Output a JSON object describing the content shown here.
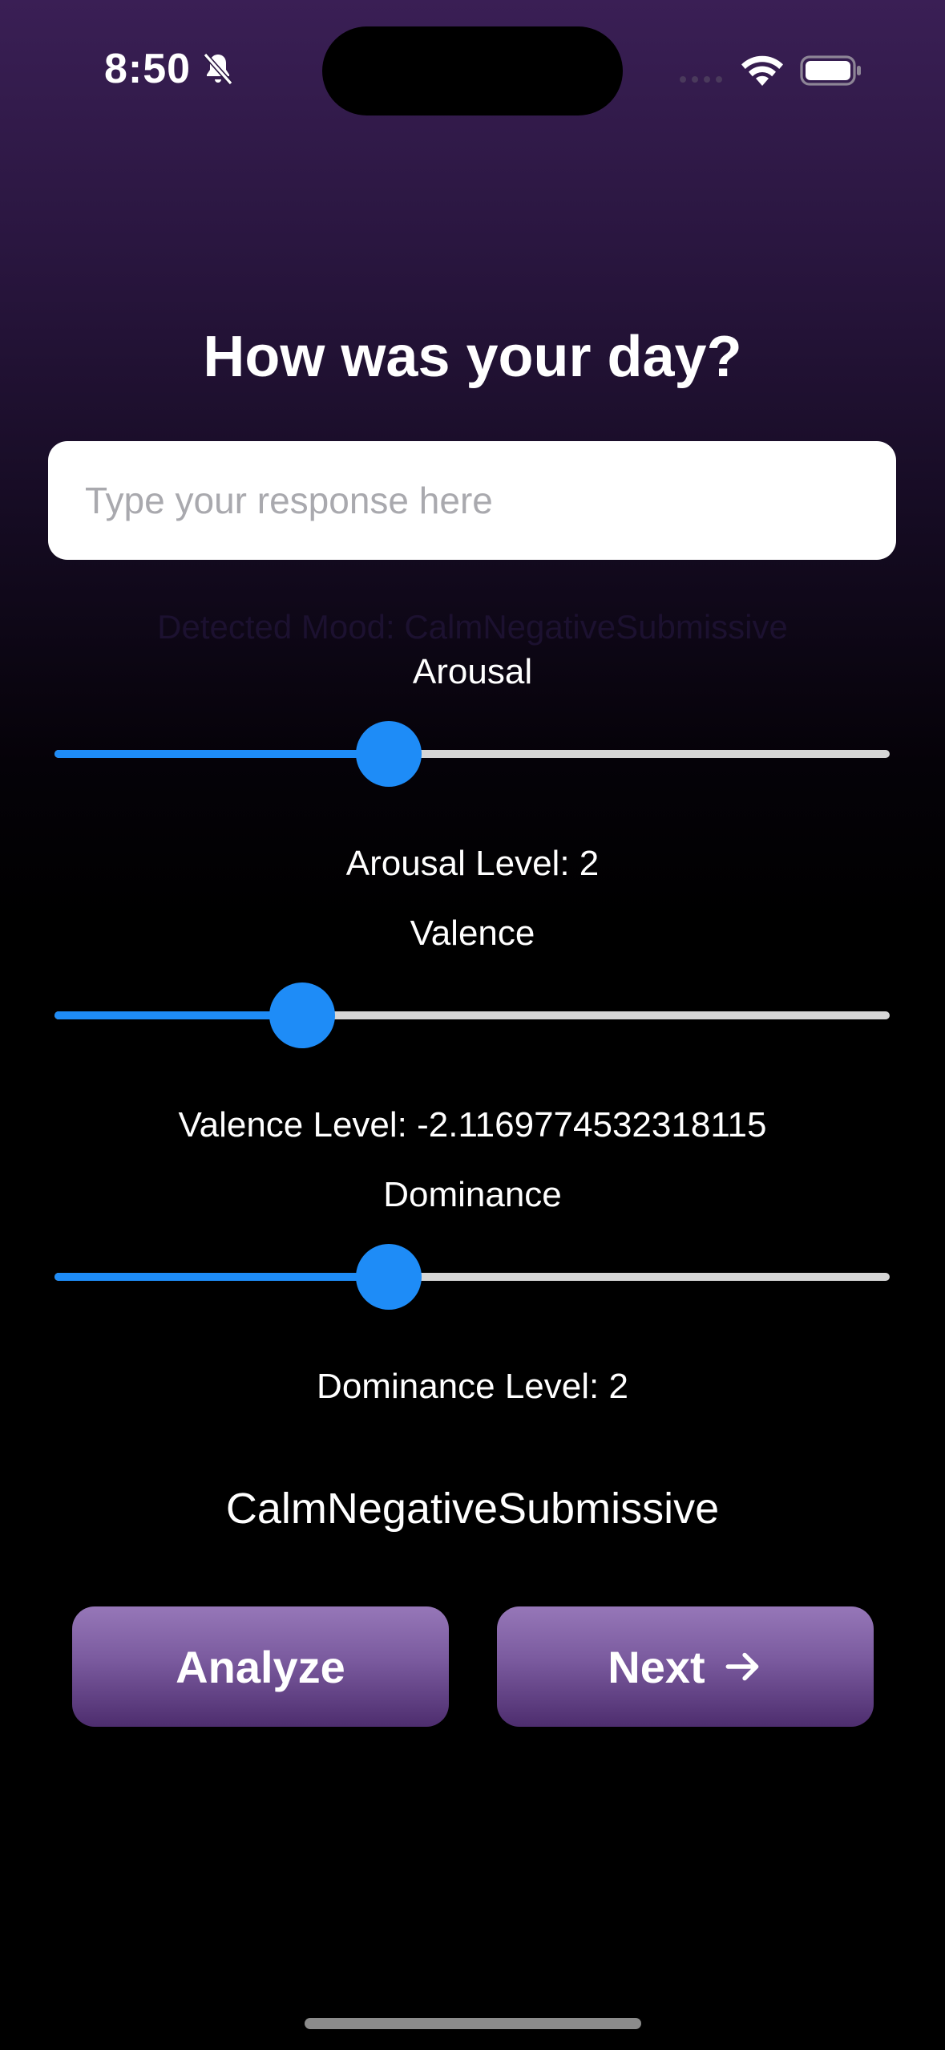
{
  "status_bar": {
    "time": "8:50",
    "icons": [
      "bell-slash-icon",
      "cellular-signal-icon",
      "wifi-icon",
      "battery-icon"
    ]
  },
  "question": {
    "title": "How was your day?"
  },
  "response_input": {
    "placeholder": "Type your response here",
    "value": ""
  },
  "detected_mood_label": "Detected Mood: CalmNegativeSubmissive",
  "sliders": {
    "arousal": {
      "label": "Arousal",
      "level_text": "Arousal Level: 2",
      "fraction": 0.4
    },
    "valence": {
      "label": "Valence",
      "level_text": "Valence Level: -2.1169774532318115",
      "fraction": 0.297
    },
    "dominance": {
      "label": "Dominance",
      "level_text": "Dominance Level: 2",
      "fraction": 0.4
    }
  },
  "mood_result": "CalmNegativeSubmissive",
  "buttons": {
    "analyze_label": "Analyze",
    "next_label": "Next"
  },
  "colors": {
    "accent": "#1e8cf7",
    "track": "#d6d6d6",
    "button_top": "#9677b8",
    "button_bottom": "#4d2d6e",
    "background_top": "#3a1f55",
    "background_bottom": "#000000"
  }
}
